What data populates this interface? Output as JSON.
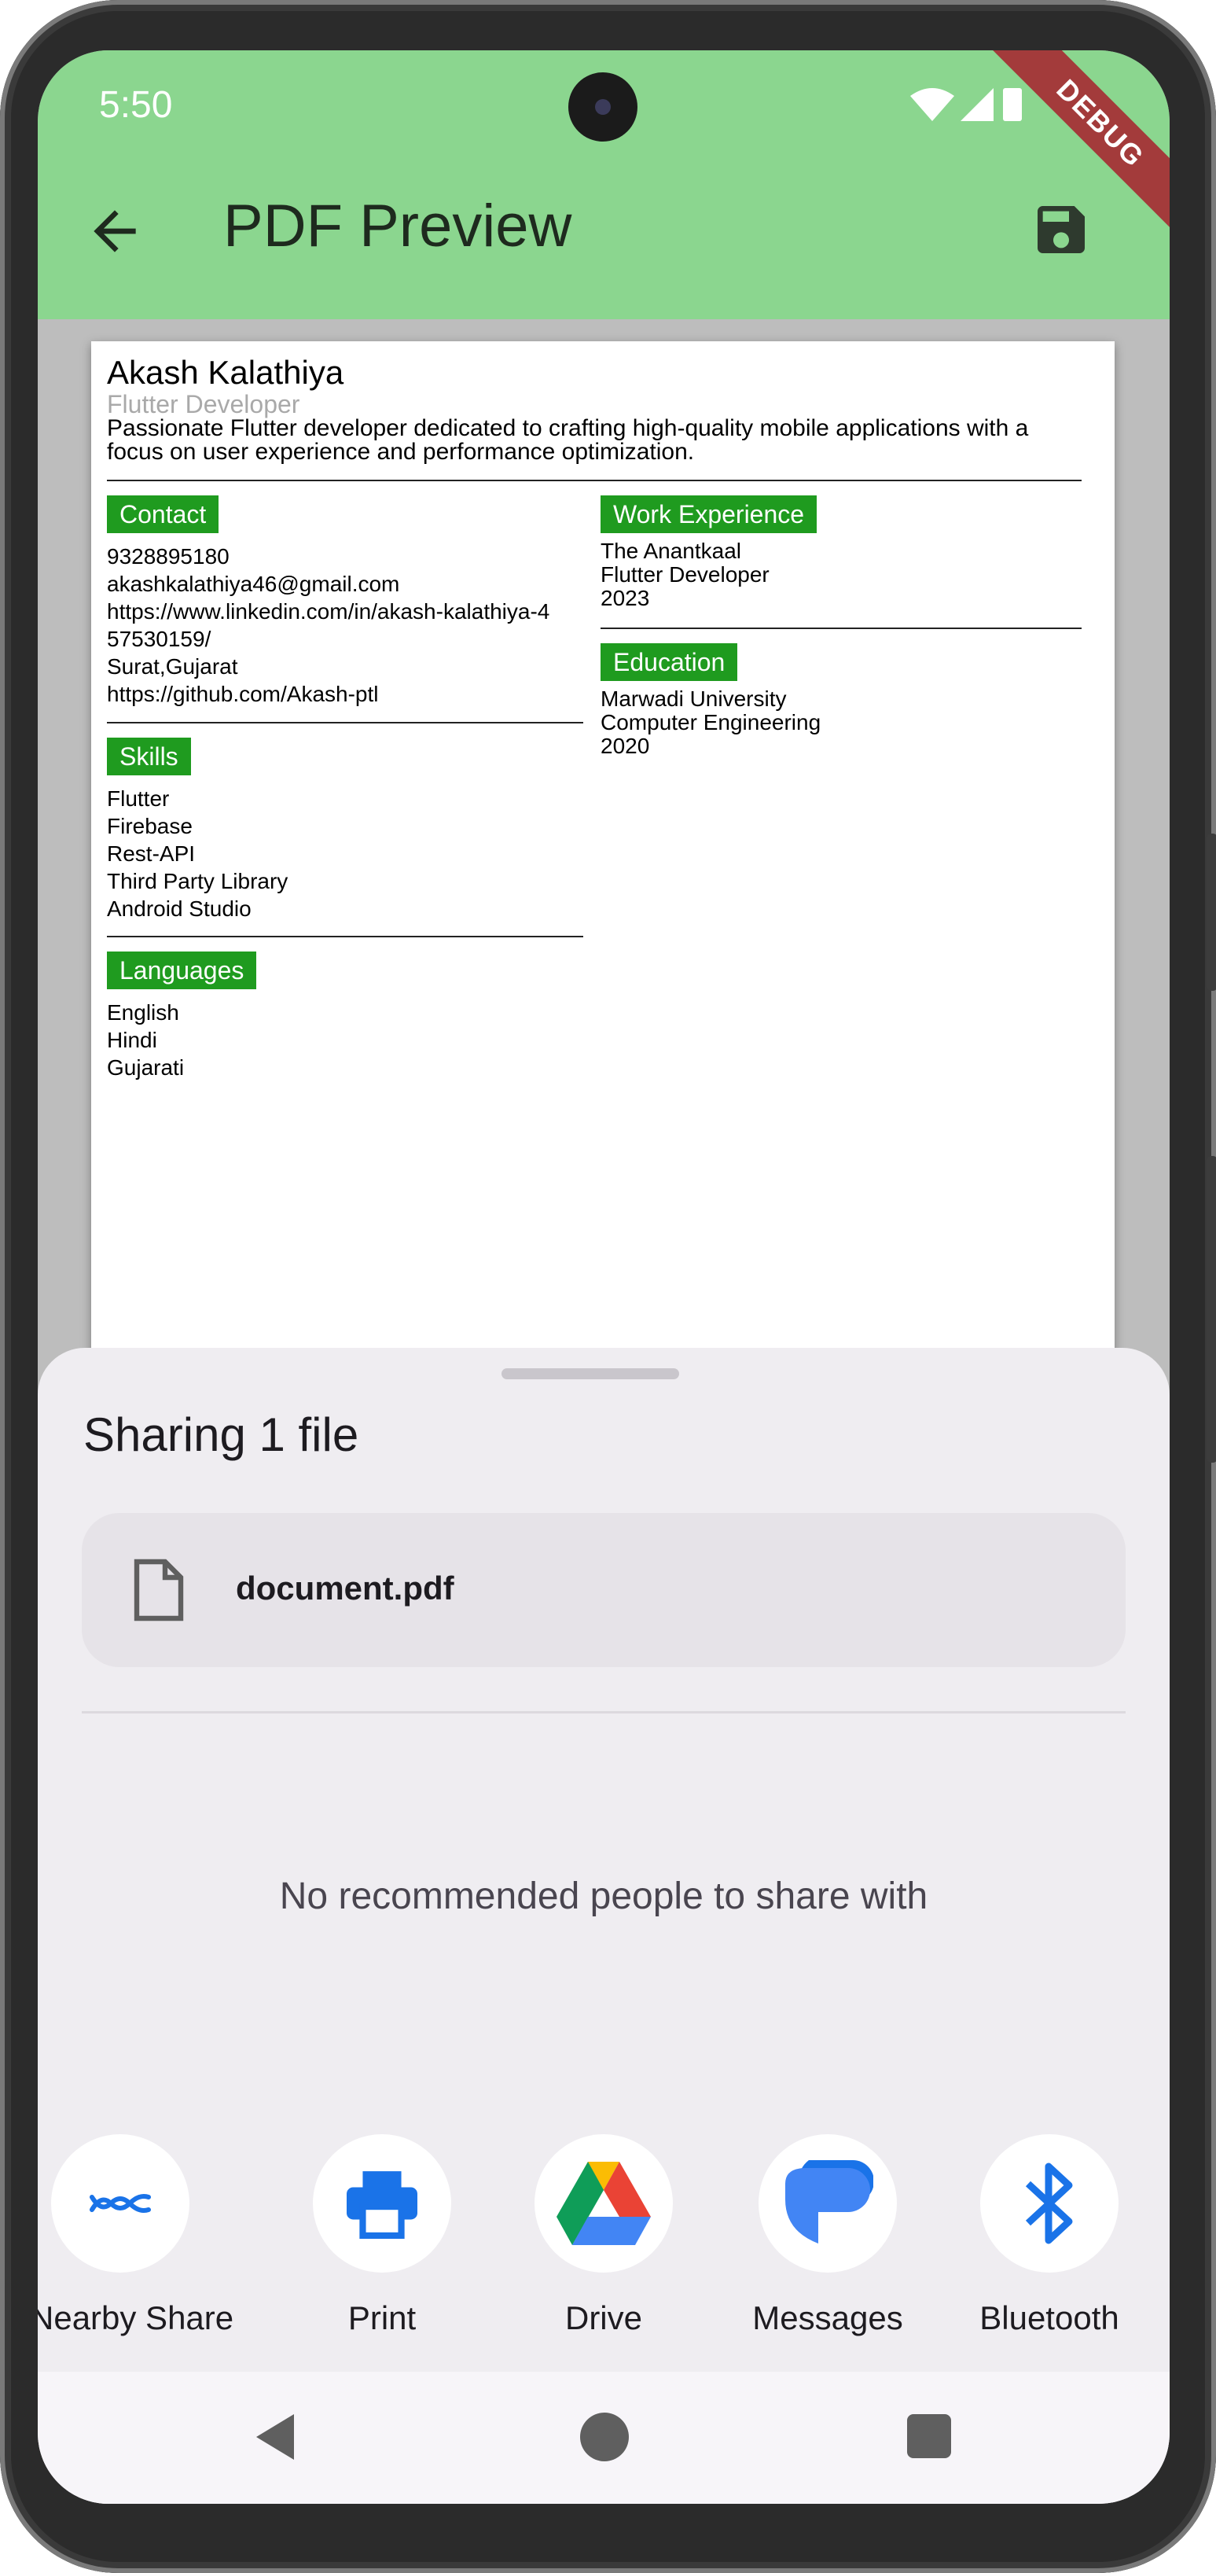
{
  "status_bar": {
    "time": "5:50",
    "debug_banner": "DEBUG"
  },
  "app_bar": {
    "title": "PDF Preview",
    "back_icon": "arrow-back-icon",
    "save_icon": "save-icon"
  },
  "pdf": {
    "name": "Akash Kalathiya",
    "role": "Flutter Developer",
    "summary": "Passionate Flutter developer dedicated to crafting high-quality mobile applications with a focus on user experience and performance optimization.",
    "contact": {
      "heading": "Contact",
      "lines": "9328895180\nakashkalathiya46@gmail.com\nhttps://www.linkedin.com/in/akash-kalathiya-4\n57530159/\nSurat,Gujarat\nhttps://github.com/Akash-ptl"
    },
    "skills": {
      "heading": "Skills",
      "lines": "Flutter\nFirebase\nRest-API\nThird Party Library\nAndroid Studio"
    },
    "languages": {
      "heading": "Languages",
      "lines": "English\nHindi\nGujarati"
    },
    "work": {
      "heading": "Work Experience",
      "lines": "The Anantkaal\nFlutter Developer\n2023"
    },
    "education": {
      "heading": "Education",
      "lines": "Marwadi University\nComputer Engineering\n2020"
    }
  },
  "share_sheet": {
    "title": "Sharing 1 file",
    "file_name": "document.pdf",
    "file_icon": "document-icon",
    "empty_people": "No recommended people to share with",
    "targets": [
      {
        "label": "Nearby Share",
        "icon": "nearby-share-icon",
        "color": "#1a73e8"
      },
      {
        "label": "Print",
        "icon": "printer-icon",
        "color": "#1a73e8"
      },
      {
        "label": "Drive",
        "icon": "google-drive-icon",
        "color": "#34a853"
      },
      {
        "label": "Messages",
        "icon": "messages-icon",
        "color": "#4285f4"
      },
      {
        "label": "Bluetooth",
        "icon": "bluetooth-icon",
        "color": "#1a73e8"
      }
    ]
  },
  "colors": {
    "app_bar": "#8bd68f",
    "badge": "#1f9b1f",
    "sheet": "#efedf1"
  }
}
